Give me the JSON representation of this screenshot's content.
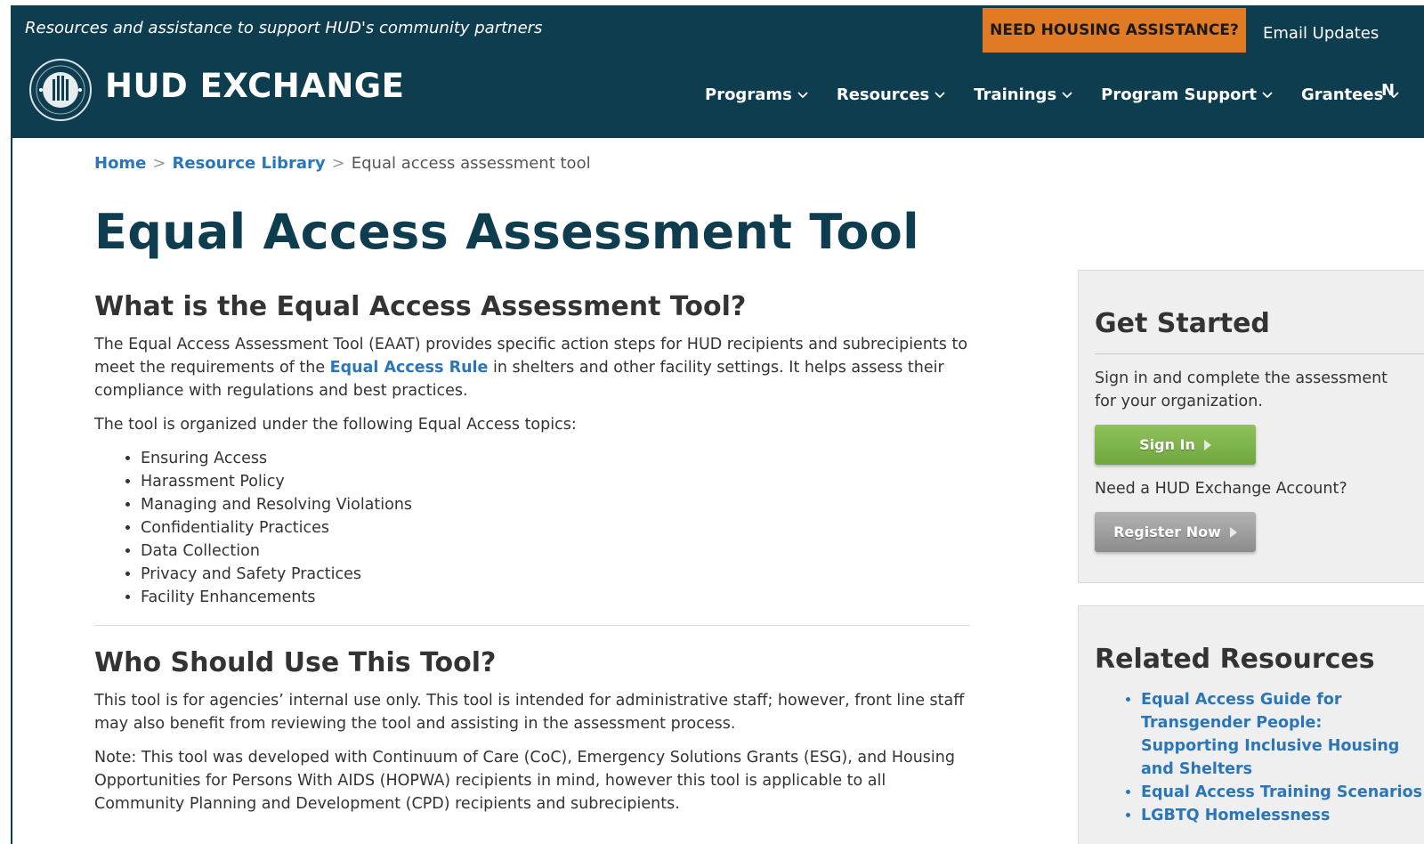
{
  "header": {
    "tagline": "Resources and assistance to support HUD's community partners",
    "need_housing": "NEED HOUSING ASSISTANCE?",
    "email_updates": "Email Updates",
    "logo_text": "HUD EXCHANGE",
    "nav": [
      "Programs",
      "Resources",
      "Trainings",
      "Program Support",
      "Grantees"
    ],
    "nav_cut": "N"
  },
  "breadcrumb": {
    "home": "Home",
    "sep": ">",
    "library": "Resource Library",
    "current": "Equal access assessment tool"
  },
  "page_title": "Equal Access Assessment Tool",
  "section1": {
    "heading": "What is the Equal Access Assessment Tool?",
    "p1_before": "The Equal Access Assessment Tool (EAAT) provides specific action steps for HUD recipients and subrecipients to meet the requirements of the ",
    "p1_link": "Equal Access Rule",
    "p1_after": " in shelters and other facility settings. It helps assess their compliance with regulations and best practices.",
    "p2": "The tool is organized under the following Equal Access topics:",
    "topics": [
      "Ensuring Access",
      "Harassment Policy",
      "Managing and Resolving Violations",
      "Confidentiality Practices",
      "Data Collection",
      "Privacy and Safety Practices",
      "Facility Enhancements"
    ]
  },
  "section2": {
    "heading": "Who Should Use This Tool?",
    "p1": "This tool is for agencies’ internal use only. This tool is intended for administrative staff; however, front line staff may also benefit from reviewing the tool and assisting in the assessment process.",
    "p2": "Note: This tool was developed with Continuum of Care (CoC), Emergency Solutions Grants (ESG), and Housing Opportunities for Persons With AIDS (HOPWA) recipients in mind, however this tool is applicable to all Community Planning and Development (CPD) recipients and subrecipients."
  },
  "get_started": {
    "heading": "Get Started",
    "text": "Sign in and complete the assessment for your organization.",
    "sign_in": "Sign In",
    "need_account": "Need a HUD Exchange Account?",
    "register": "Register Now"
  },
  "related": {
    "heading": "Related Resources",
    "items": [
      "Equal Access Guide for Transgender People: Supporting Inclusive Housing and Shelters",
      "Equal Access Training Scenarios",
      "LGBTQ Homelessness"
    ]
  },
  "colors": {
    "header_bg": "#0e3d4f",
    "accent_orange": "#e07a25",
    "link_blue": "#2b76b9",
    "button_green": "#7db34a",
    "button_gray": "#a0a0a0"
  }
}
